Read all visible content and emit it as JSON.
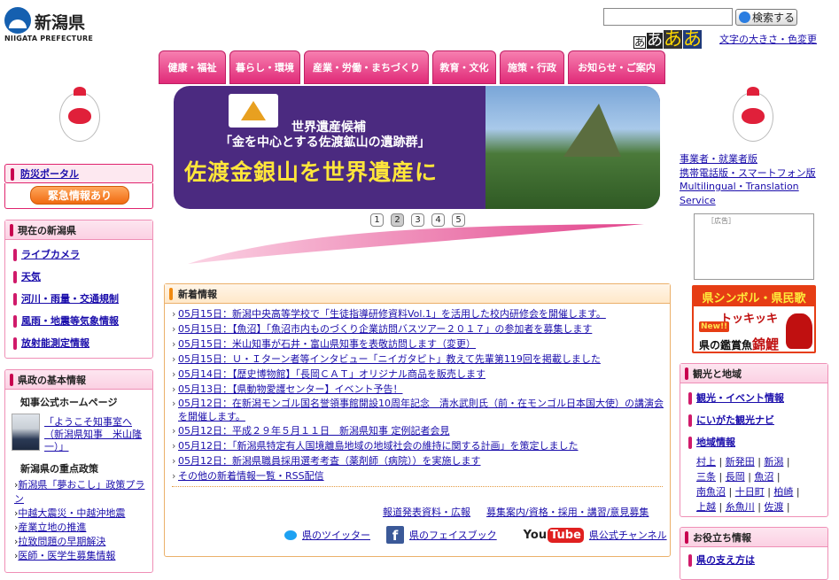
{
  "logo": {
    "jp": "新潟県",
    "en": "NIIGATA PREFECTURE"
  },
  "search": {
    "button": "検索する",
    "placeholder": ""
  },
  "fontsize": {
    "labels": [
      "あ",
      "あ",
      "あ",
      "あ"
    ],
    "link": "文字の大きさ・色変更"
  },
  "nav": [
    "健康・福祉",
    "暮らし・環境",
    "産業・労働・まちづくり",
    "教育・文化",
    "施策・行政",
    "お知らせ・ご案内"
  ],
  "banner": {
    "line1": "世界遺産候補",
    "line2": "「金を中心とする佐渡鉱山の遺跡群」",
    "line3": "佐渡金銀山を世界遺産に"
  },
  "pager": [
    "1",
    "2",
    "3",
    "4",
    "5"
  ],
  "bousai": {
    "title": "防災ポータル",
    "alert": "緊急情報あり"
  },
  "current": {
    "title": "現在の新潟県",
    "items": [
      "ライブカメラ",
      "天気",
      "河川・雨量・交通規制",
      "風雨・地震等気象情報",
      "放射能測定情報"
    ]
  },
  "kensei": {
    "title": "県政の基本情報",
    "governor_title": "知事公式ホームページ",
    "governor_link": "「ようこそ知事室へ（新潟県知事　米山隆一）」",
    "policy_title": "新潟県の重点政策",
    "policy_items": [
      "新潟県「夢おこし」政策プラン",
      "中越大震災・中越沖地震",
      "産業立地の推進",
      "拉致問題の早期解決",
      "医師・医学生募集情報"
    ]
  },
  "news": {
    "title": "新着情報",
    "items": [
      "05月15日：新潟中央高等学校で「生徒指導研修資料Vol.1」を活用した校内研修会を開催します。",
      "05月15日：【魚沼】「魚沼市内ものづくり企業訪問バスツアー２０１７」の参加者を募集します",
      "05月15日：米山知事が石井・富山県知事を表敬訪問します（変更）",
      "05月15日：Ｕ・Ｉターン者等インタビュー「ニイガタピト」教えて先輩第119回を掲載しました",
      "05月14日：【歴史博物館】「長岡ＣＡＴ」オリジナル商品を販売します",
      "05月13日：【県動物愛護センター】イベント予告！",
      "05月12日：在新潟モンゴル国名誉領事館開設10周年記念　清水武則氏（前・在モンゴル日本国大使）の講演会を開催します。",
      "05月12日：平成２９年５月１１日　新潟県知事 定例記者会見",
      "05月12日：「新潟県特定有人国境離島地域の地域社会の維持に関する計画」を策定しました",
      "05月12日：新潟県職員採用選考考査（薬剤師（病院））を実施します",
      "その他の新着情報一覧・RSS配信"
    ],
    "links": [
      "報道発表資料・広報",
      "募集案内/資格・採用・講習/意見募集"
    ],
    "social": {
      "twitter": "県のツイッター",
      "facebook": "県のフェイスブック",
      "youtube": "県公式チャンネル",
      "yt_logo_a": "You",
      "yt_logo_b": "Tube",
      "fb_logo": "f"
    }
  },
  "right_links": [
    "事業者・就業者版",
    "携帯電話版・スマートフォン版",
    "Multilingual・Translation Service"
  ],
  "ad_label": "［広告］",
  "kenmin": {
    "top": "県シンボル・県民歌",
    "mid": "トッキッキ",
    "new": "New!!",
    "bot_a": "県の鑑賞魚",
    "bot_b": "錦鯉"
  },
  "kanko": {
    "title": "観光と地域",
    "items": [
      "観光・イベント情報",
      "にいがた観光ナビ",
      "地域情報"
    ],
    "cities": [
      "村上",
      "新発田",
      "新潟",
      "三条",
      "長岡",
      "魚沼",
      "南魚沼",
      "十日町",
      "柏崎",
      "上越",
      "糸魚川",
      "佐渡"
    ]
  },
  "oyakudachi": {
    "title": "お役立ち情報",
    "first": "県の支え方は"
  }
}
